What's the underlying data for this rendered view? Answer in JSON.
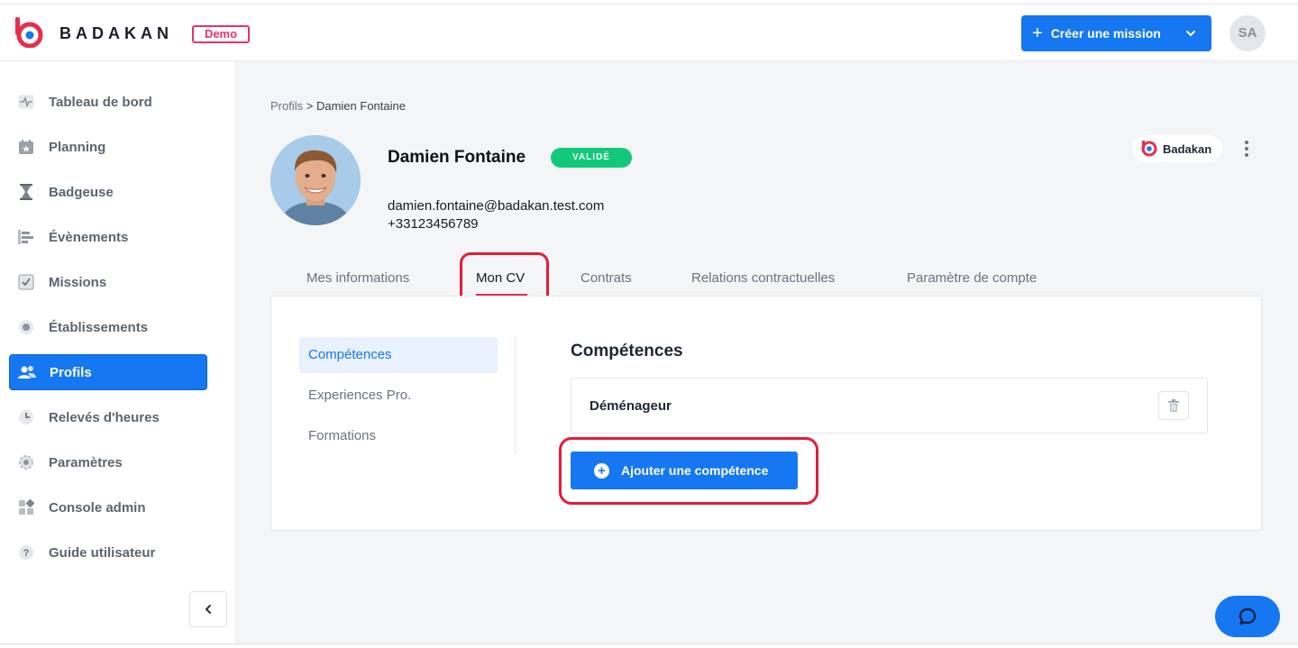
{
  "header": {
    "brand": "BADAKAN",
    "badge": "Demo",
    "create_button": "Créer une mission",
    "user_initials": "SA"
  },
  "sidebar": {
    "items": [
      {
        "label": "Tableau de bord",
        "icon": "pulse-icon"
      },
      {
        "label": "Planning",
        "icon": "calendar-star-icon"
      },
      {
        "label": "Badgeuse",
        "icon": "hourglass-icon"
      },
      {
        "label": "Évènements",
        "icon": "timeline-icon"
      },
      {
        "label": "Missions",
        "icon": "checkbox-icon"
      },
      {
        "label": "Établissements",
        "icon": "building-icon"
      },
      {
        "label": "Profils",
        "icon": "users-icon"
      },
      {
        "label": "Relevés d'heures",
        "icon": "clock-icon"
      },
      {
        "label": "Paramètres",
        "icon": "gear-icon"
      },
      {
        "label": "Console admin",
        "icon": "grid-icon"
      },
      {
        "label": "Guide utilisateur",
        "icon": "help-icon"
      }
    ],
    "active_index": 6
  },
  "breadcrumb": {
    "parent": "Profils",
    "separator": ">",
    "current": "Damien Fontaine"
  },
  "profile": {
    "name": "Damien Fontaine",
    "status": "VALIDÉ",
    "email": "damien.fontaine@badakan.test.com",
    "phone": "+33123456789",
    "organization": "Badakan"
  },
  "tabs": [
    {
      "label": "Mes informations"
    },
    {
      "label": "Mon CV"
    },
    {
      "label": "Contrats"
    },
    {
      "label": "Relations contractuelles"
    },
    {
      "label": "Paramètre de compte"
    }
  ],
  "active_tab": 1,
  "cv": {
    "submenu": [
      {
        "label": "Compétences"
      },
      {
        "label": "Experiences Pro."
      },
      {
        "label": "Formations"
      }
    ],
    "active_submenu": 0,
    "section_title": "Compétences",
    "skills": [
      {
        "name": "Déménageur"
      }
    ],
    "add_button": "Ajouter une compétence"
  },
  "colors": {
    "accent": "#1677f2",
    "brand_red": "#e62e4d",
    "highlight": "#e41b3a",
    "success": "#12c97a"
  }
}
